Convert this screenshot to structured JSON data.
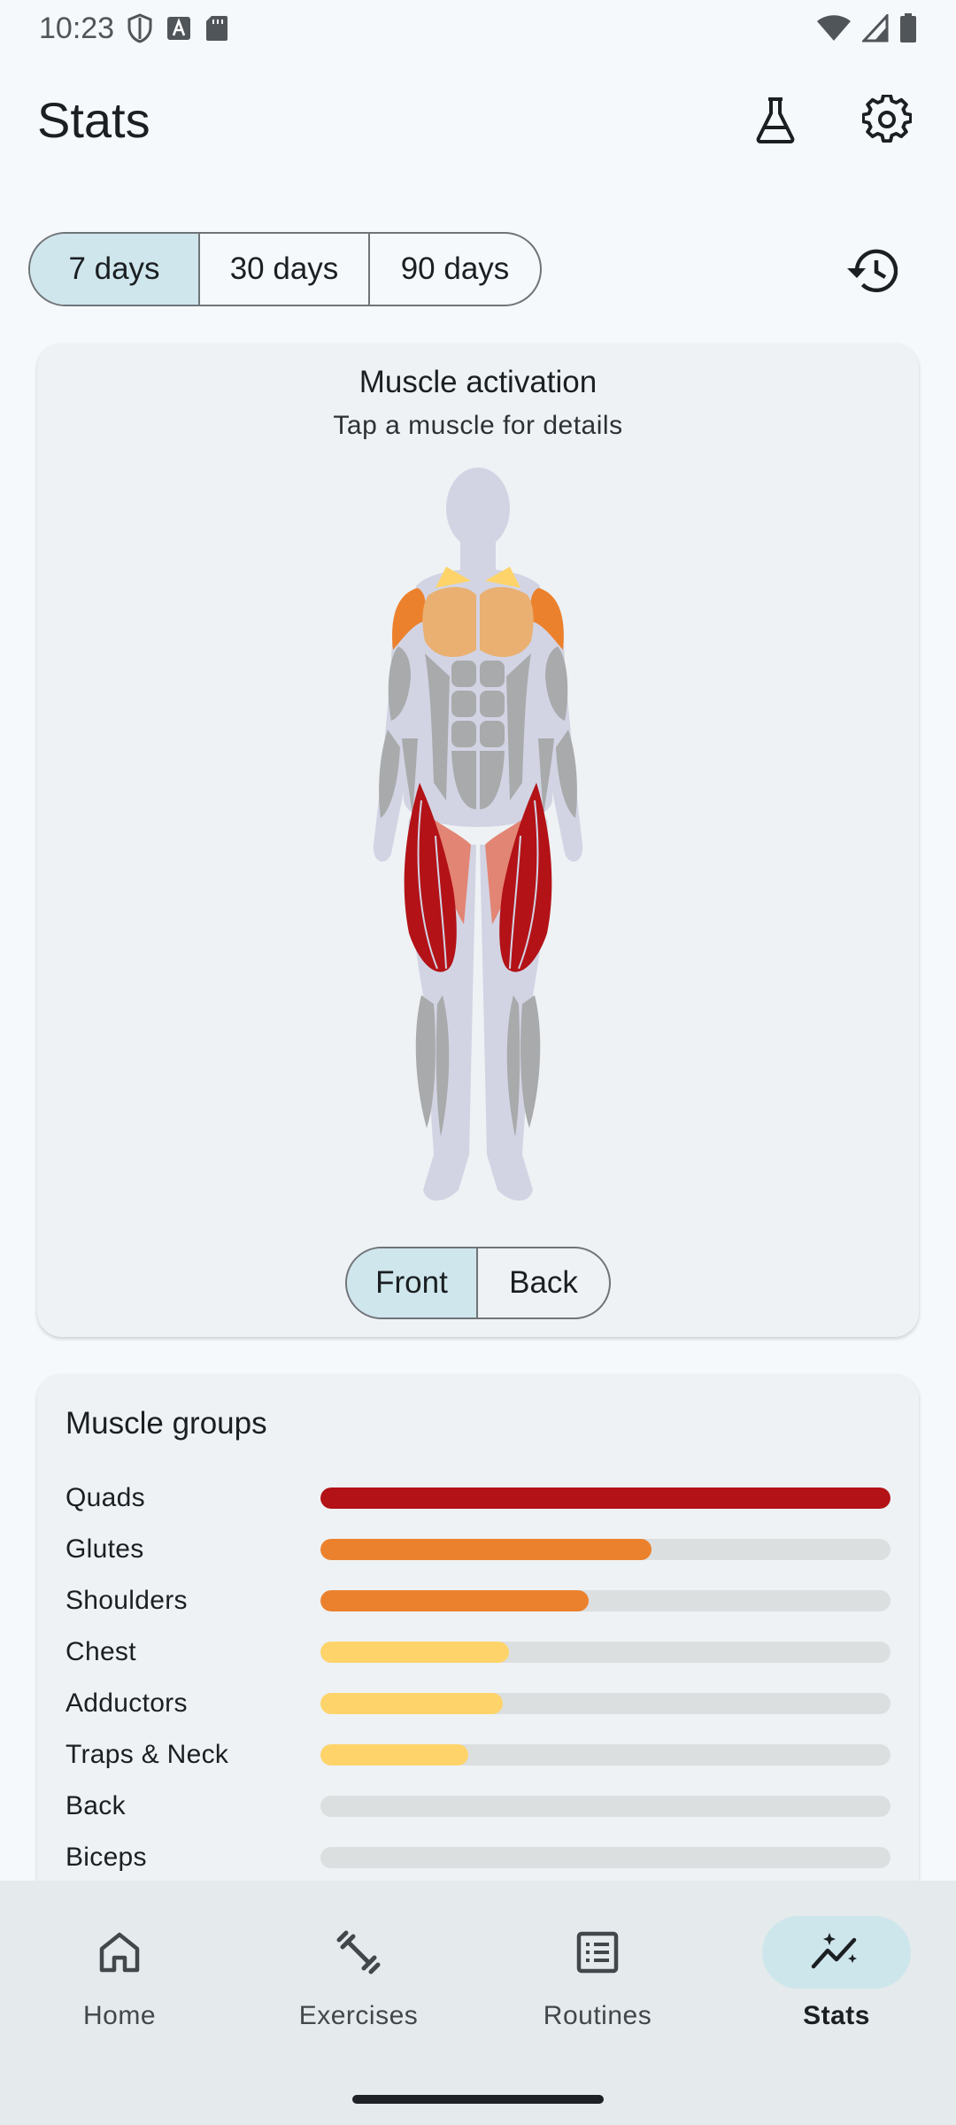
{
  "status_bar": {
    "time": "10:23"
  },
  "header": {
    "title": "Stats",
    "lab_icon": "flask-icon",
    "settings_icon": "gear-icon"
  },
  "range": {
    "options": [
      "7 days",
      "30 days",
      "90 days"
    ],
    "selected": "7 days",
    "history_icon": "history-icon"
  },
  "activation": {
    "title": "Muscle activation",
    "subtitle": "Tap a muscle for details",
    "view_options": [
      "Front",
      "Back"
    ],
    "selected_view": "Front"
  },
  "groups": {
    "title": "Muscle groups",
    "items": [
      {
        "label": "Quads",
        "level": 1.0,
        "color": "#b31217"
      },
      {
        "label": "Glutes",
        "level": 0.58,
        "color": "#ec812d"
      },
      {
        "label": "Shoulders",
        "level": 0.47,
        "color": "#ec812d"
      },
      {
        "label": "Chest",
        "level": 0.33,
        "color": "#fed46a"
      },
      {
        "label": "Adductors",
        "level": 0.32,
        "color": "#fed46a"
      },
      {
        "label": "Traps & Neck",
        "level": 0.26,
        "color": "#fed46a"
      },
      {
        "label": "Back",
        "level": 0.0,
        "color": "#fed46a"
      },
      {
        "label": "Biceps",
        "level": 0.0,
        "color": "#fed46a"
      }
    ]
  },
  "nav": {
    "items": [
      {
        "label": "Home",
        "icon": "home-icon"
      },
      {
        "label": "Exercises",
        "icon": "dumbbell-icon"
      },
      {
        "label": "Routines",
        "icon": "list-icon"
      },
      {
        "label": "Stats",
        "icon": "chart-sparkle-icon"
      }
    ],
    "active": "Stats"
  },
  "colors": {
    "high": "#b31217",
    "medium": "#ec812d",
    "low": "#fed46a",
    "muscle_idle": "#a9aaab",
    "body": "#d2d4e4",
    "selected_bg": "#cfe6ec"
  }
}
